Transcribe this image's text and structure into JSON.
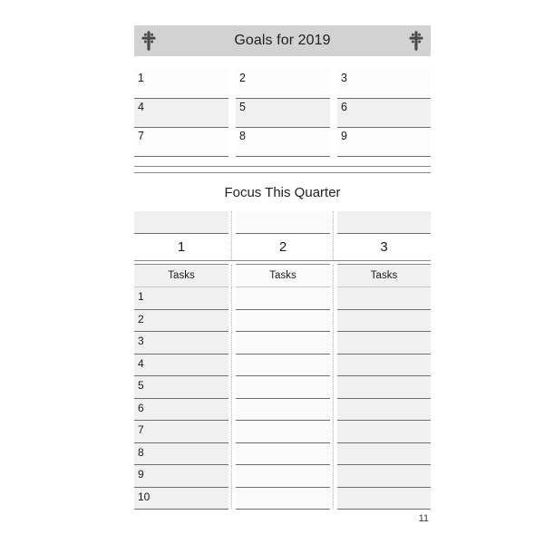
{
  "header": {
    "title": "Goals for 2019",
    "left_icon": "cross-icon",
    "right_icon": "cross-icon",
    "background_color": "#d2d2d2"
  },
  "goals": {
    "rows": [
      [
        "1",
        "2",
        "3"
      ],
      [
        "4",
        "5",
        "6"
      ],
      [
        "7",
        "8",
        "9"
      ]
    ]
  },
  "focus": {
    "title": "Focus This Quarter",
    "blank_row": [
      "",
      "",
      ""
    ],
    "column_numbers": [
      "1",
      "2",
      "3"
    ],
    "task_headers": [
      "Tasks",
      "Tasks",
      "Tasks"
    ],
    "task_rows": [
      [
        "1",
        "",
        ""
      ],
      [
        "2",
        "",
        ""
      ],
      [
        "3",
        "",
        ""
      ],
      [
        "4",
        "",
        ""
      ],
      [
        "5",
        "",
        ""
      ],
      [
        "6",
        "",
        ""
      ],
      [
        "7",
        "",
        ""
      ],
      [
        "8",
        "",
        ""
      ],
      [
        "9",
        "",
        ""
      ],
      [
        "10",
        "",
        ""
      ]
    ]
  },
  "footer": {
    "page_number": "11"
  }
}
